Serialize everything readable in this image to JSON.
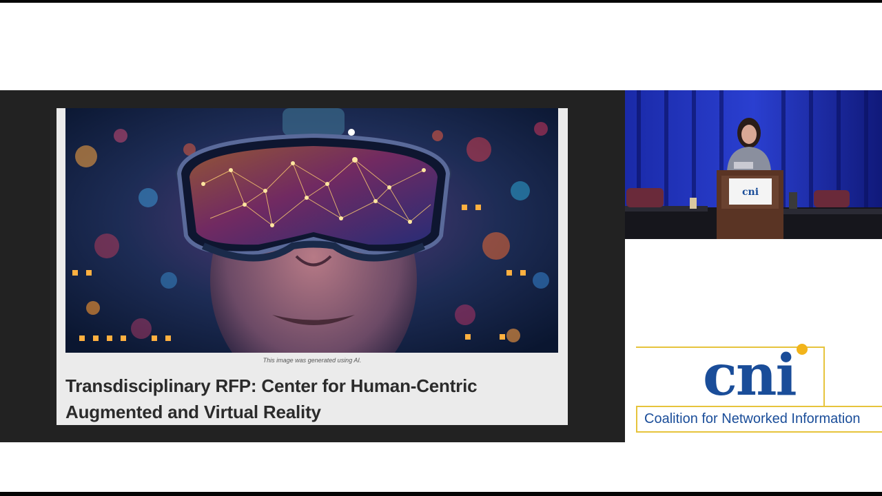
{
  "slide": {
    "image_caption": "This image was generated using AI.",
    "title": "Transdisciplinary RFP: Center for Human-Centric Augmented and Virtual Reality"
  },
  "speaker_video": {
    "podium_sign": "cni"
  },
  "logo": {
    "letters": "cni",
    "tagline": "Coalition for Networked Information"
  },
  "colors": {
    "brand_blue": "#1a4d99",
    "brand_gold": "#e6c33b",
    "slide_bg": "#222222",
    "card_bg": "#ebebeb"
  }
}
